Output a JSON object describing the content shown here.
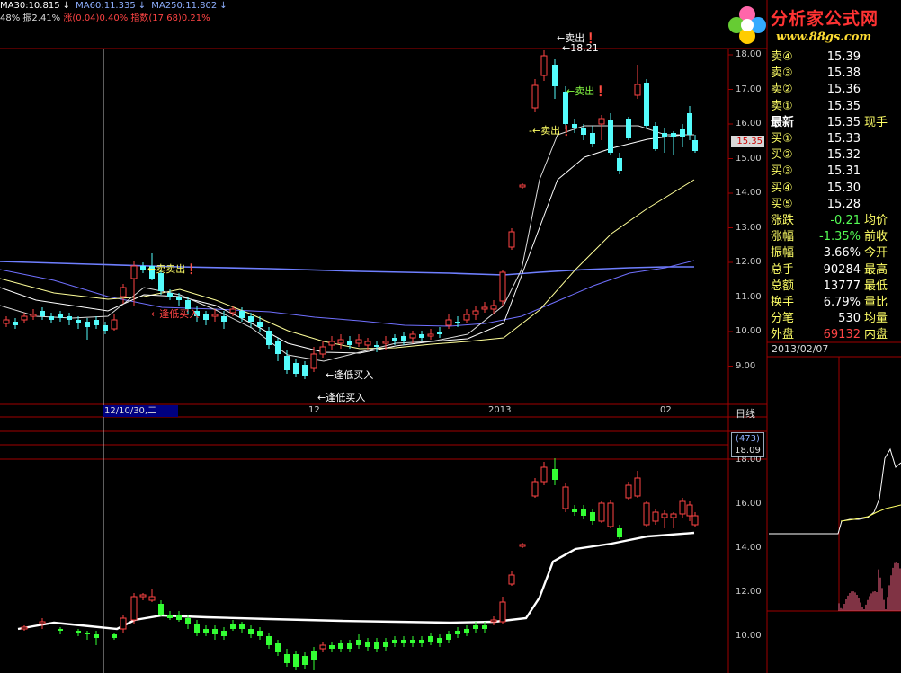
{
  "ma_bar": {
    "ma30": "MA30:10.815",
    "ma60": "MA60:11.335",
    "ma250": "MA250:11.802",
    "arrow": "↓"
  },
  "indicator_bar": {
    "left": "48% 振2.41%",
    "zhang": "涨",
    "zhang_val": "(0.04)0.40%",
    "index": "指数",
    "index_val": "(17.68)0.21%"
  },
  "logo": {
    "title": "分析家公式网",
    "url": "www.88gs.com"
  },
  "price_axis": [
    "18.00",
    "17.00",
    "16.00",
    "15.00",
    "14.00",
    "13.00",
    "12.00",
    "11.00",
    "10.00",
    "9.00"
  ],
  "current_price_tag": "15.35",
  "date_axis": {
    "selected": "12/10/30,二",
    "labels": [
      "12",
      "2013",
      "02"
    ],
    "period": "日线"
  },
  "volume_box": {
    "count": "(473)",
    "value": "18.09"
  },
  "lower_axis": [
    "18.00",
    "16.00",
    "14.00",
    "12.00",
    "10.00"
  ],
  "annotations": {
    "sell1": "卖出",
    "sell_price": "18.21",
    "sell2": "卖出",
    "sell3": "卖出",
    "sell4": "卖卖出",
    "buy1": "逢低买入",
    "buy2": "逢低买入",
    "buy3": "逢低买入"
  },
  "quote": {
    "rows": [
      {
        "label": "卖④",
        "value": "15.39",
        "extra": ""
      },
      {
        "label": "卖③",
        "value": "15.38",
        "extra": ""
      },
      {
        "label": "卖②",
        "value": "15.36",
        "extra": ""
      },
      {
        "label": "卖①",
        "value": "15.35",
        "extra": ""
      },
      {
        "label": "最新",
        "value": "15.35",
        "extra": "现手"
      },
      {
        "label": "买①",
        "value": "15.33",
        "extra": ""
      },
      {
        "label": "买②",
        "value": "15.32",
        "extra": ""
      },
      {
        "label": "买③",
        "value": "15.31",
        "extra": ""
      },
      {
        "label": "买④",
        "value": "15.30",
        "extra": ""
      },
      {
        "label": "买⑤",
        "value": "15.28",
        "extra": ""
      },
      {
        "label": "涨跌",
        "value": "-0.21",
        "extra": "均价"
      },
      {
        "label": "涨幅",
        "value": "-1.35%",
        "extra": "前收"
      },
      {
        "label": "振幅",
        "value": "3.66%",
        "extra": "今开"
      },
      {
        "label": "总手",
        "value": "90284",
        "extra": "最高"
      },
      {
        "label": "总额",
        "value": "13777",
        "extra": "最低"
      },
      {
        "label": "换手",
        "value": "6.79%",
        "extra": "量比"
      },
      {
        "label": "分笔",
        "value": "530",
        "extra": "均量"
      },
      {
        "label": "外盘",
        "value": "69132",
        "extra": "内盘"
      }
    ],
    "date": "2013/02/07"
  },
  "colors": {
    "up": "#ff4444",
    "down": "#54fcfc",
    "ma_blue": "#7f8fff",
    "ma_yellow": "#ffff99",
    "grid_red": "#a00000"
  }
}
